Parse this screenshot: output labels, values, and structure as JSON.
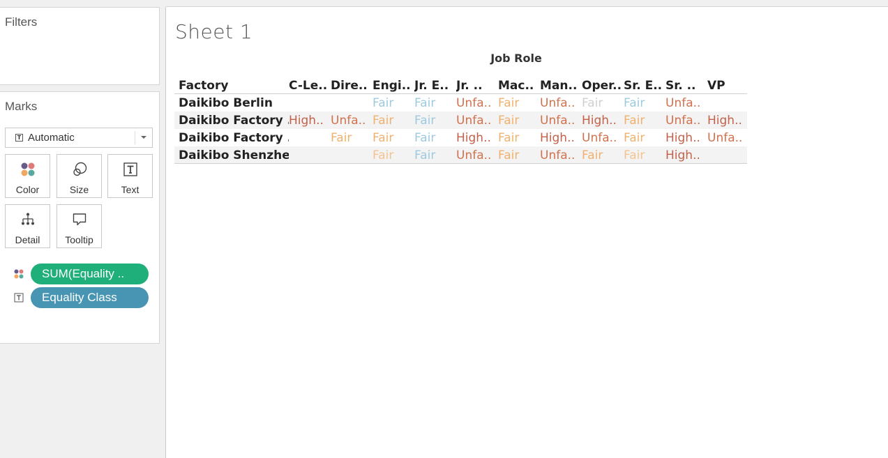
{
  "sidebar": {
    "filters_title": "Filters",
    "marks_title": "Marks",
    "mark_type": "Automatic",
    "buttons": [
      {
        "label": "Color",
        "icon": "color-dots-icon"
      },
      {
        "label": "Size",
        "icon": "size-circles-icon"
      },
      {
        "label": "Text",
        "icon": "text-t-icon"
      },
      {
        "label": "Detail",
        "icon": "detail-tree-icon"
      },
      {
        "label": "Tooltip",
        "icon": "tooltip-bubble-icon"
      }
    ],
    "pills": [
      {
        "label": "SUM(Equality ..",
        "color": "#1faf7a",
        "icon": "color-dots-icon"
      },
      {
        "label": "Equality Class",
        "color": "#4795b3",
        "icon": "text-t-icon"
      }
    ]
  },
  "sheet": {
    "title": "Sheet 1",
    "column_group": "Job Role",
    "row_header": "Factory",
    "columns": [
      "C-Le..",
      "Dire..",
      "Engi..",
      "Jr. E..",
      "Jr. ..",
      "Mac..",
      "Man..",
      "Oper..",
      "Sr. E..",
      "Sr. ..",
      "VP"
    ],
    "rows": [
      {
        "factory": "Daikibo Berlin",
        "cells": [
          "",
          "",
          "Fair",
          "Fair",
          "Unfa..",
          "Fair",
          "Unfa..",
          "Fair",
          "Fair",
          "Unfa..",
          ""
        ],
        "tones": [
          "",
          "",
          "fair-blue",
          "fair-blue",
          "unfair",
          "fair-orange",
          "unfair",
          "fair-gray",
          "fair-blue",
          "unfair",
          ""
        ]
      },
      {
        "factory": "Daikibo Factory ..",
        "cells": [
          "High..",
          "Unfa..",
          "Fair",
          "Fair",
          "Unfa..",
          "Fair",
          "Unfa..",
          "High..",
          "Fair",
          "Unfa..",
          "High.."
        ],
        "tones": [
          "high",
          "unfair",
          "fair-orange",
          "fair-blue",
          "unfair",
          "fair-orange",
          "unfair",
          "high",
          "fair-orange",
          "unfair",
          "high"
        ]
      },
      {
        "factory": "Daikibo Factory ..",
        "cells": [
          "",
          "Fair",
          "Fair",
          "Fair",
          "High..",
          "Fair",
          "High..",
          "Unfa..",
          "Fair",
          "High..",
          "Unfa.."
        ],
        "tones": [
          "",
          "fair-orange",
          "fair-orange",
          "fair-blue",
          "high",
          "fair-orange",
          "high",
          "unfair",
          "fair-orange",
          "high",
          "unfair"
        ]
      },
      {
        "factory": "Daikibo Shenzhen",
        "cells": [
          "",
          "",
          "Fair",
          "Fair",
          "Unfa..",
          "Fair",
          "Unfa..",
          "Fair",
          "Fair",
          "High..",
          ""
        ],
        "tones": [
          "",
          "",
          "fair-orange-light",
          "fair-blue",
          "unfair",
          "fair-orange",
          "unfair",
          "fair-orange",
          "fair-orange-light",
          "high",
          ""
        ]
      }
    ]
  },
  "colors": {
    "fair-blue": "#9ccbe0",
    "fair-orange": "#f0b16e",
    "fair-orange-light": "#f4c48f",
    "fair-gray": "#cfcfcf",
    "unfair": "#d1714d",
    "high": "#c4614a"
  }
}
